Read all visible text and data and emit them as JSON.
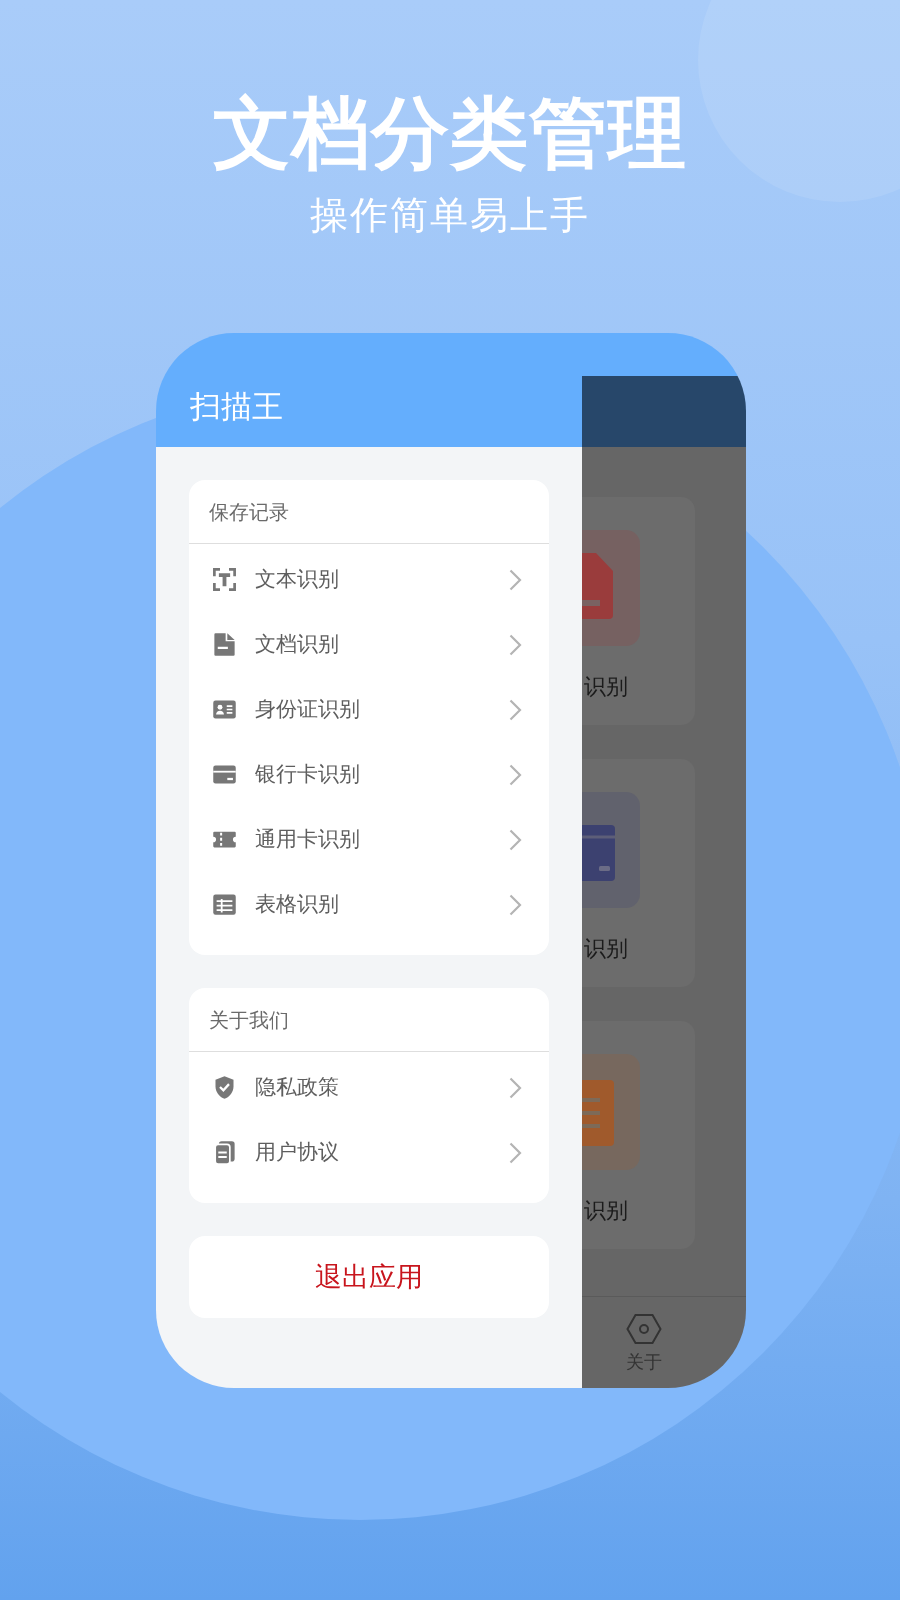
{
  "hero": {
    "title": "文档分类管理",
    "subtitle": "操作简单易上手"
  },
  "drawer": {
    "title": "扫描王",
    "sections": [
      {
        "kind": "list",
        "header": "保存记录",
        "items": [
          {
            "label": "文本识别"
          },
          {
            "label": "文档识别"
          },
          {
            "label": "身份证识别"
          },
          {
            "label": "银行卡识别"
          },
          {
            "label": "通用卡识别"
          },
          {
            "label": "表格识别"
          }
        ]
      },
      {
        "kind": "list",
        "header": "关于我们",
        "items": [
          {
            "label": "隐私政策"
          },
          {
            "label": "用户协议"
          }
        ]
      },
      {
        "kind": "action",
        "label": "退出应用"
      }
    ]
  },
  "behind_drawer": {
    "cards": [
      {
        "label": "识别",
        "color": "#9a3c3c"
      },
      {
        "label": "识别",
        "color": "#3c4170"
      },
      {
        "label": "识别",
        "color": "#a05a2c"
      }
    ],
    "tab_bar": [
      {
        "label": "关于"
      }
    ]
  }
}
